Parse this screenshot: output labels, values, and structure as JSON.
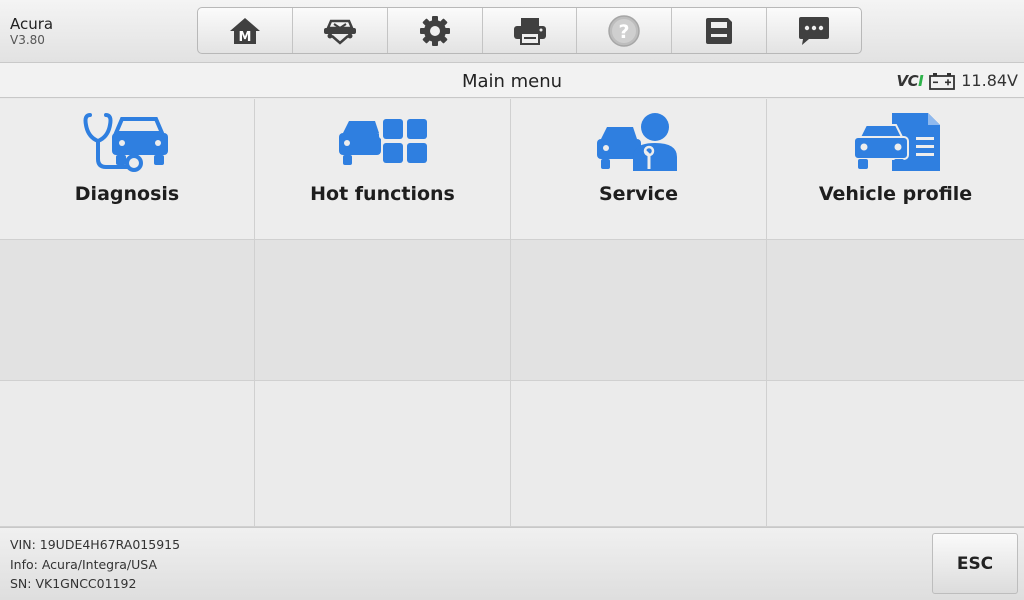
{
  "app": {
    "brand": "Acura",
    "version": "V3.80"
  },
  "toolbar": {
    "buttons": [
      {
        "name": "home-icon",
        "glyph": "M"
      },
      {
        "name": "vehicle-swap-icon"
      },
      {
        "name": "settings-gear-icon"
      },
      {
        "name": "printer-icon"
      },
      {
        "name": "help-icon",
        "glyph": "?"
      },
      {
        "name": "save-icon"
      },
      {
        "name": "message-icon"
      }
    ]
  },
  "header": {
    "title": "Main menu",
    "vci_prefix": "VC",
    "vci_suffix": "I",
    "voltage": "11.84V"
  },
  "menu": {
    "items": [
      {
        "label": "Diagnosis",
        "icon": "diagnosis-stethoscope-car-icon"
      },
      {
        "label": "Hot functions",
        "icon": "hot-functions-car-grid-icon"
      },
      {
        "label": "Service",
        "icon": "service-technician-car-icon"
      },
      {
        "label": "Vehicle profile",
        "icon": "vehicle-profile-document-car-icon"
      }
    ]
  },
  "footer": {
    "vin": "VIN: 19UDE4H67RA015915",
    "info": "Info: Acura/Integra/USA",
    "sn": "SN: VK1GNCC01192",
    "esc_label": "ESC"
  },
  "colors": {
    "icon_blue": "#2f7fe0",
    "vci_green": "#2db34a"
  }
}
